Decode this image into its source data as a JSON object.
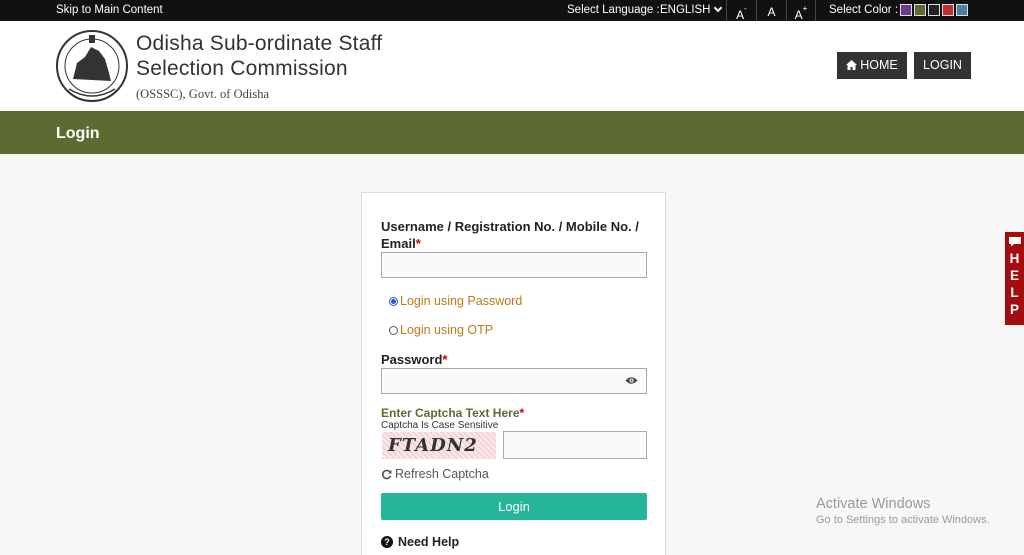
{
  "topbar": {
    "skip_link": "Skip to Main Content",
    "language_label": "Select Language :",
    "language_value": "ENGLISH",
    "font_decrease": "A",
    "font_normal": "A",
    "font_increase": "A",
    "color_label": "Select Color :",
    "swatches": [
      "#6a3d8f",
      "#5d6b32",
      "#222222",
      "#c42b2b",
      "#4d7ea8"
    ]
  },
  "header": {
    "org_line1": "Odisha Sub-ordinate Staff",
    "org_line2": "Selection Commission",
    "org_line3": "(OSSSC), Govt. of Odisha",
    "home_button": "HOME",
    "login_button": "LOGIN"
  },
  "banner": {
    "title": "Login"
  },
  "form": {
    "username_label_line1": "Username / Registration No. / Mobile No. /",
    "username_label_line2": "Email",
    "required_mark": "*",
    "username_value": "",
    "radio_password": "Login using Password",
    "radio_otp": "Login using OTP",
    "selected_mode": "password",
    "password_label": "Password",
    "password_value": "",
    "captcha_label": "Enter Captcha Text Here",
    "captcha_sub": "Captcha Is Case Sensitive",
    "captcha_text": "FTADN2",
    "captcha_value": "",
    "refresh_label": "Refresh Captcha",
    "submit_label": "Login",
    "need_help": "Need Help"
  },
  "help_tab": {
    "letters": [
      "H",
      "E",
      "L",
      "P"
    ]
  },
  "watermark": {
    "line1": "Activate Windows",
    "line2": "Go to Settings to activate Windows."
  }
}
